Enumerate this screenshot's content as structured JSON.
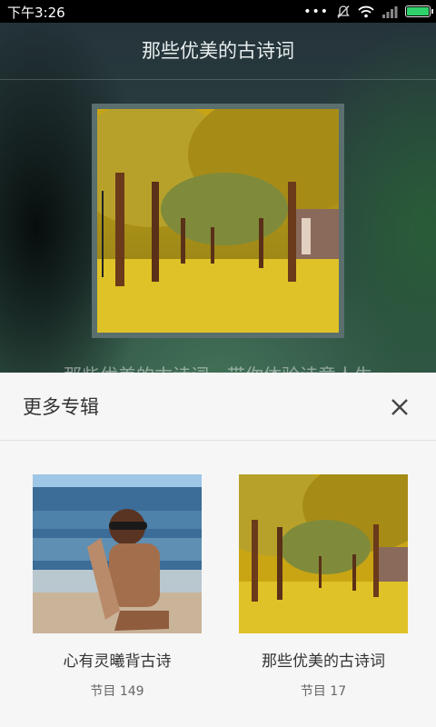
{
  "status_bar": {
    "time": "下午3:26"
  },
  "header": {
    "title": "那些优美的古诗词"
  },
  "background": {
    "partial_text": "那些优美的古诗词，带你体验诗意人生"
  },
  "sheet": {
    "title": "更多专辑",
    "albums": [
      {
        "name": "心有灵曦背古诗",
        "count": "节目 149"
      },
      {
        "name": "那些优美的古诗词",
        "count": "节目 17"
      }
    ]
  },
  "colors": {
    "battery": "#2ed16a",
    "sheet_bg": "#f6f6f6",
    "ginkgo_yellow": "#d9b21f"
  }
}
